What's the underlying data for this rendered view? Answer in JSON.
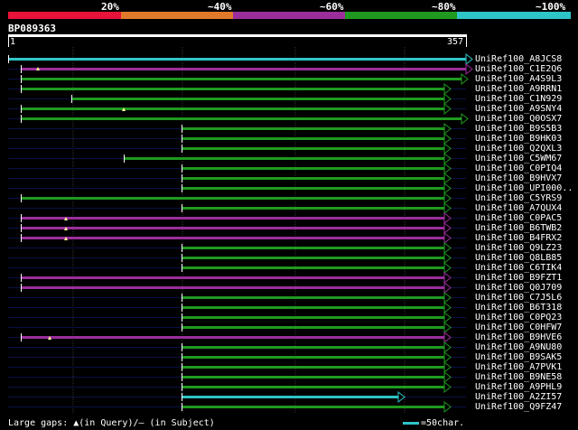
{
  "legend": {
    "labels": [
      "20%",
      "~40%",
      "~60%",
      "~80%",
      "~100%"
    ],
    "colors": [
      "#e8133a",
      "#e07a2a",
      "#9b2e9b",
      "#1f9a1f",
      "#2ec4c8"
    ]
  },
  "query": {
    "id": "BP089363",
    "start": "1",
    "end": "357"
  },
  "hits": [
    {
      "name": "UniRef100_A8JCS8",
      "color": "cyan"
    },
    {
      "name": "UniRef100_C1E2Q6",
      "color": "purple"
    },
    {
      "name": "UniRef100_A4S9L3",
      "color": "green"
    },
    {
      "name": "UniRef100_A9RRN1",
      "color": "green"
    },
    {
      "name": "UniRef100_C1N929",
      "color": "green"
    },
    {
      "name": "UniRef100_A9SNY4",
      "color": "green"
    },
    {
      "name": "UniRef100_Q0OSX7",
      "color": "green"
    },
    {
      "name": "UniRef100_B9S5B3",
      "color": "green"
    },
    {
      "name": "UniRef100_B9HK03",
      "color": "green"
    },
    {
      "name": "UniRef100_Q2QXL3",
      "color": "green"
    },
    {
      "name": "UniRef100_C5WM67",
      "color": "green"
    },
    {
      "name": "UniRef100_C0PIQ4",
      "color": "green"
    },
    {
      "name": "UniRef100_B9HVX7",
      "color": "green"
    },
    {
      "name": "UniRef100_UPI000..",
      "color": "green"
    },
    {
      "name": "UniRef100_C5YRS9",
      "color": "green"
    },
    {
      "name": "UniRef100_A7QUX4",
      "color": "green"
    },
    {
      "name": "UniRef100_C0PAC5",
      "color": "purple"
    },
    {
      "name": "UniRef100_B6TWB2",
      "color": "purple"
    },
    {
      "name": "UniRef100_B4FRX2",
      "color": "purple"
    },
    {
      "name": "UniRef100_Q9LZ23",
      "color": "green"
    },
    {
      "name": "UniRef100_Q8LB85",
      "color": "green"
    },
    {
      "name": "UniRef100_C6TIK4",
      "color": "green"
    },
    {
      "name": "UniRef100_B9FZT1",
      "color": "purple"
    },
    {
      "name": "UniRef100_Q0J709",
      "color": "purple"
    },
    {
      "name": "UniRef100_C7J5L6",
      "color": "green"
    },
    {
      "name": "UniRef100_B6T318",
      "color": "green"
    },
    {
      "name": "UniRef100_C0PQ23",
      "color": "green"
    },
    {
      "name": "UniRef100_C0HFW7",
      "color": "green"
    },
    {
      "name": "UniRef100_B9HVE6",
      "color": "purple"
    },
    {
      "name": "UniRef100_A9NU80",
      "color": "green"
    },
    {
      "name": "UniRef100_B9SAK5",
      "color": "green"
    },
    {
      "name": "UniRef100_A7PVK1",
      "color": "green"
    },
    {
      "name": "UniRef100_B9NE58",
      "color": "green"
    },
    {
      "name": "UniRef100_A9PHL9",
      "color": "green"
    },
    {
      "name": "UniRef100_A2ZI57",
      "color": "cyan"
    },
    {
      "name": "UniRef100_Q9FZ47",
      "color": "green"
    }
  ],
  "footer": {
    "gaps_text": "Large gaps: ▲(in Query)/— (in Subject)",
    "scale_text": "=50char."
  }
}
